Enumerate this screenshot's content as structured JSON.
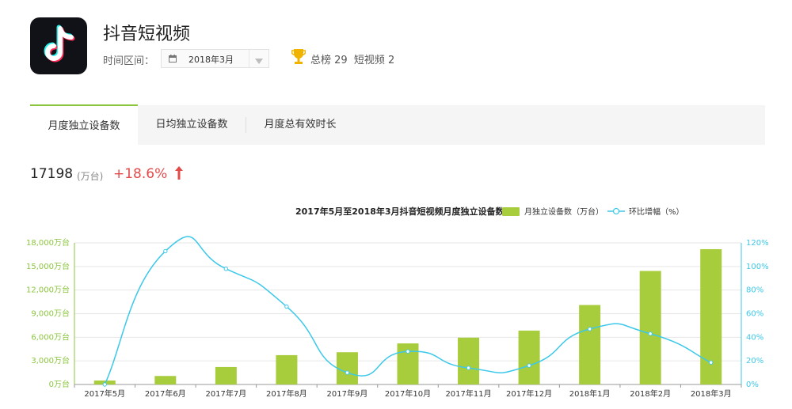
{
  "app": {
    "title": "抖音短视频",
    "range_label": "时间区间：",
    "date_value": "2018年3月",
    "rank_total": "总榜 29",
    "rank_category": "短视频 2"
  },
  "tabs": [
    {
      "label": "月度独立设备数",
      "active": true
    },
    {
      "label": "日均独立设备数",
      "active": false
    },
    {
      "label": "月度总有效时长",
      "active": false
    }
  ],
  "metric": {
    "value": "17198",
    "unit": "(万台)",
    "change": "+18.6%",
    "trend": "up"
  },
  "colors": {
    "bar": "#a8cd3c",
    "line": "#3cc8ea",
    "accent": "#8cc63f",
    "positive_change": "#e34a4a"
  },
  "chart_data": {
    "type": "bar",
    "title": "2017年5月至2018年3月抖音短视频月度独立设备数",
    "categories": [
      "2017年5月",
      "2017年6月",
      "2017年7月",
      "2017年8月",
      "2017年9月",
      "2017年10月",
      "2017年11月",
      "2017年12月",
      "2018年1月",
      "2018年2月",
      "2018年3月"
    ],
    "series": [
      {
        "name": "月独立设备数（万台）",
        "type": "bar",
        "axis": "left",
        "values": [
          500,
          1080,
          2220,
          3730,
          4100,
          5220,
          5950,
          6850,
          10100,
          14430,
          17198
        ]
      },
      {
        "name": "环比增幅（%）",
        "type": "line",
        "axis": "right",
        "values": [
          0,
          113,
          98,
          66,
          10,
          28,
          14,
          16,
          47,
          43,
          18.6
        ]
      }
    ],
    "y_left": {
      "min": 0,
      "max": 18000,
      "ticks": [
        "0万台",
        "3,000万台",
        "6,000万台",
        "9,000万台",
        "12,000万台",
        "15,000万台",
        "18,000万台"
      ]
    },
    "y_right": {
      "min": 0,
      "max": 120,
      "ticks": [
        "0%",
        "20%",
        "40%",
        "60%",
        "80%",
        "100%",
        "120%"
      ]
    },
    "grid": true,
    "legend": "top-right"
  }
}
